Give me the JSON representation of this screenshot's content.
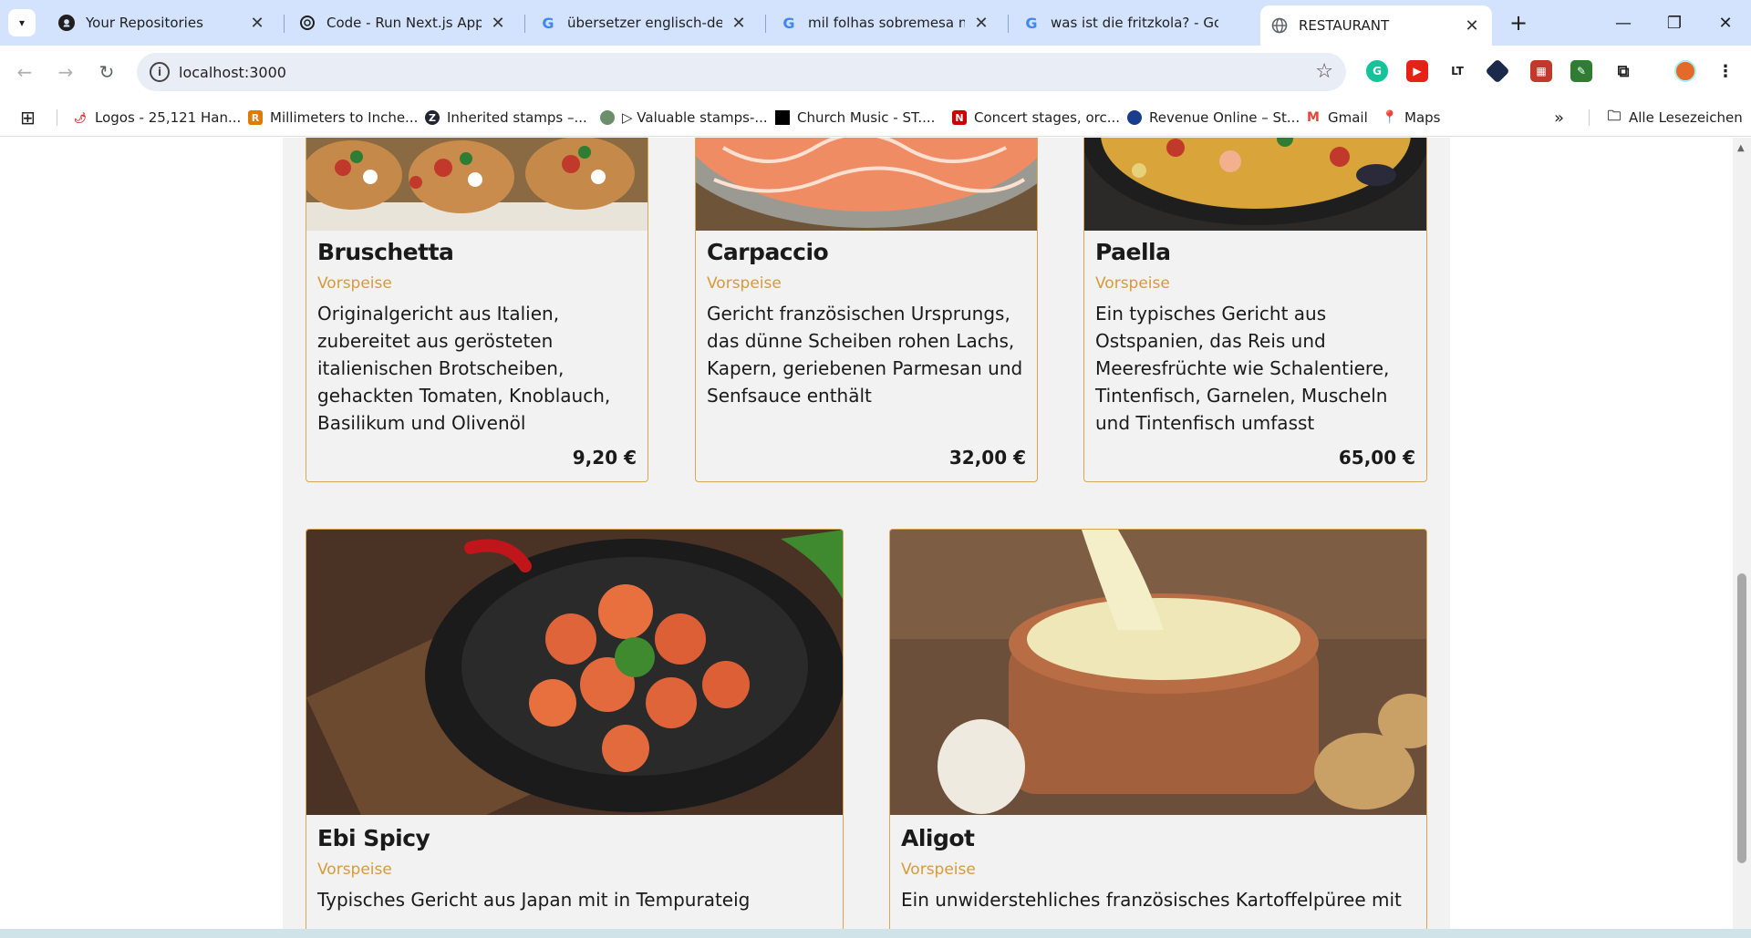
{
  "browser": {
    "tabs": [
      {
        "title": "Your Repositories",
        "icon": "github-icon"
      },
      {
        "title": "Code - Run Next.js App in",
        "icon": "openai-icon"
      },
      {
        "title": "übersetzer englisch-deutsc",
        "icon": "google-icon"
      },
      {
        "title": "mil folhas sobremesa nome",
        "icon": "google-icon"
      },
      {
        "title": "was ist die fritzkola? - Goo",
        "icon": "google-icon"
      },
      {
        "title": "RESTAURANT",
        "icon": "globe-icon",
        "active": true
      }
    ],
    "address": "localhost:3000",
    "bookmarks": [
      {
        "label": "Logos - 25,121 Han...",
        "color": "#d33"
      },
      {
        "label": "Millimeters to Inche...",
        "color": "#e07a00",
        "glyph": "R"
      },
      {
        "label": "Inherited stamps –...",
        "color": "#223",
        "glyph": "Z"
      },
      {
        "label": "▷ Valuable stamps-...",
        "color": "#6b8e6b"
      },
      {
        "label": "Church Music - ST....",
        "color": "#000"
      },
      {
        "label": "Concert stages, orc...",
        "color": "#c00",
        "glyph": "N"
      },
      {
        "label": "Revenue Online – St...",
        "color": "#1a3c8c"
      },
      {
        "label": "Gmail",
        "color": "#ea4335",
        "glyph": "M"
      },
      {
        "label": "Maps",
        "color": "#34a853"
      }
    ],
    "all_bookmarks_label": "Alle Lesezeichen"
  },
  "menu": {
    "items": [
      {
        "name": "Bruschetta",
        "category": "Vorspeise",
        "description": "Originalgericht aus Italien, zubereitet aus gerösteten italienischen Brotscheiben, gehackten Tomaten, Knoblauch, Basilikum und Olivenöl",
        "price": "9,20 €"
      },
      {
        "name": "Carpaccio",
        "category": "Vorspeise",
        "description": "Gericht französischen Ursprungs, das dünne Scheiben rohen Lachs, Kapern, geriebenen Parmesan und Senfsauce enthält",
        "price": "32,00 €"
      },
      {
        "name": "Paella",
        "category": "Vorspeise",
        "description": "Ein typisches Gericht aus Ostspanien, das Reis und Meeresfrüchte wie Schalentiere, Tintenfisch, Garnelen, Muscheln und Tintenfisch umfasst",
        "price": "65,00 €"
      },
      {
        "name": "Ebi Spicy",
        "category": "Vorspeise",
        "description": "Typisches Gericht aus Japan mit in Tempurateig"
      },
      {
        "name": "Aligot",
        "category": "Vorspeise",
        "description": "Ein unwiderstehliches französisches Kartoffelpüree mit"
      }
    ]
  },
  "colors": {
    "accent": "#d79a3a",
    "card_border": "#d8a657",
    "page_bg": "#f2f2f2"
  }
}
